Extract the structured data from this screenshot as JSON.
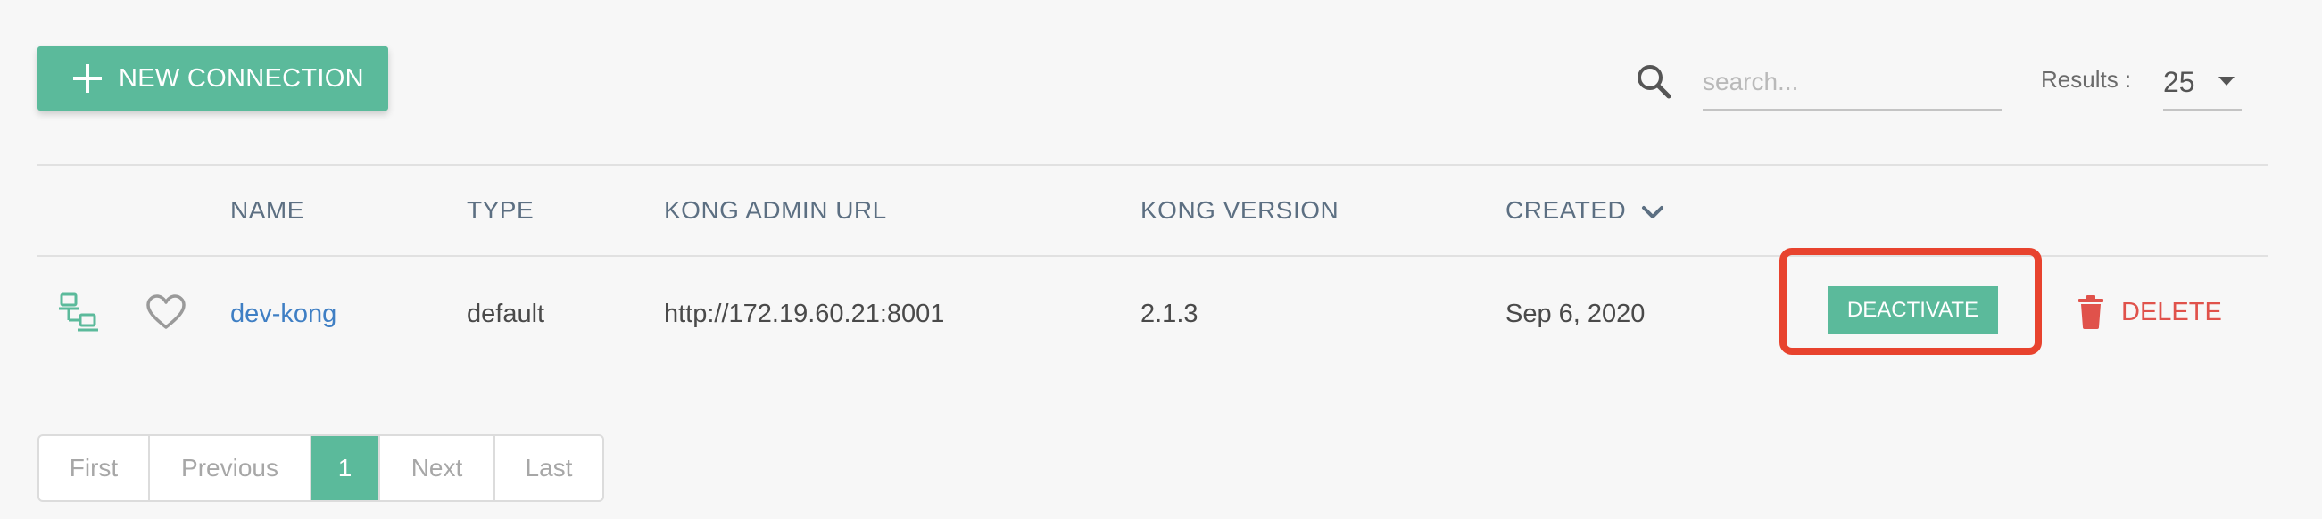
{
  "toolbar": {
    "new_connection_label": "NEW CONNECTION",
    "search_placeholder": "search...",
    "search_value": "",
    "results_label": "Results :",
    "results_value": "25"
  },
  "table": {
    "columns": [
      "NAME",
      "TYPE",
      "KONG ADMIN URL",
      "KONG VERSION",
      "CREATED"
    ],
    "rows": [
      {
        "name": "dev-kong",
        "type": "default",
        "url": "http://172.19.60.21:8001",
        "version": "2.1.3",
        "created": "Sep 6, 2020",
        "deactivate_label": "DEACTIVATE",
        "delete_label": "DELETE"
      }
    ]
  },
  "pagination": {
    "first": "First",
    "previous": "Previous",
    "current": "1",
    "next": "Next",
    "last": "Last"
  },
  "colors": {
    "accent": "#5bba9b",
    "link": "#3f7fc4",
    "danger": "#e0524b",
    "highlight": "#e8432e"
  },
  "icons": {
    "new_connection": "plus-icon",
    "search": "search-icon",
    "sort": "chevron-down-icon",
    "connection": "network-icon",
    "favorite": "heart-icon",
    "delete": "trash-icon"
  }
}
